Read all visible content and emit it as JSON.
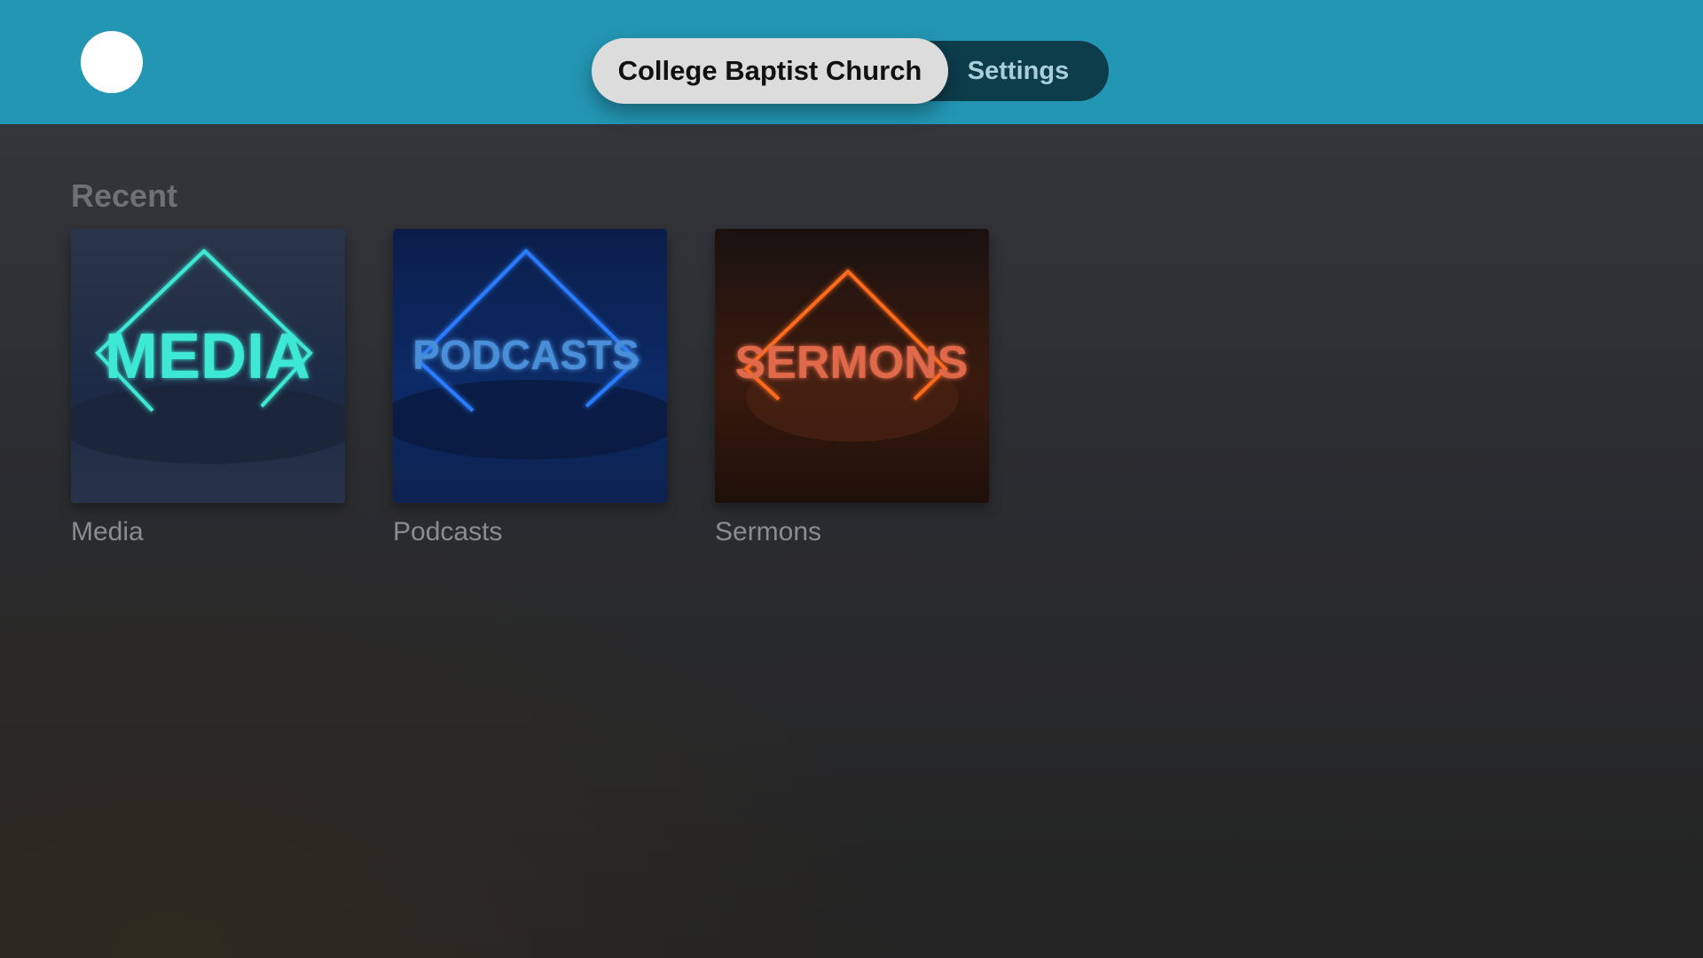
{
  "header": {
    "tabs": [
      {
        "label": "College Baptist Church",
        "selected": true
      },
      {
        "label": "Settings",
        "selected": false
      }
    ]
  },
  "recent": {
    "title": "Recent",
    "items": [
      {
        "label": "Media",
        "artwork_text": "MEDIA",
        "accent_color": "#3ee8d4"
      },
      {
        "label": "Podcasts",
        "artwork_text": "PODCASTS",
        "accent_color": "#2b7bff"
      },
      {
        "label": "Sermons",
        "artwork_text": "SERMONS",
        "accent_color": "#ff6a1a"
      }
    ]
  },
  "colors": {
    "header_bg": "#2396b3",
    "tab_selected_bg": "#dcdcdc",
    "tab_bar_bg": "#0d3c4b"
  }
}
